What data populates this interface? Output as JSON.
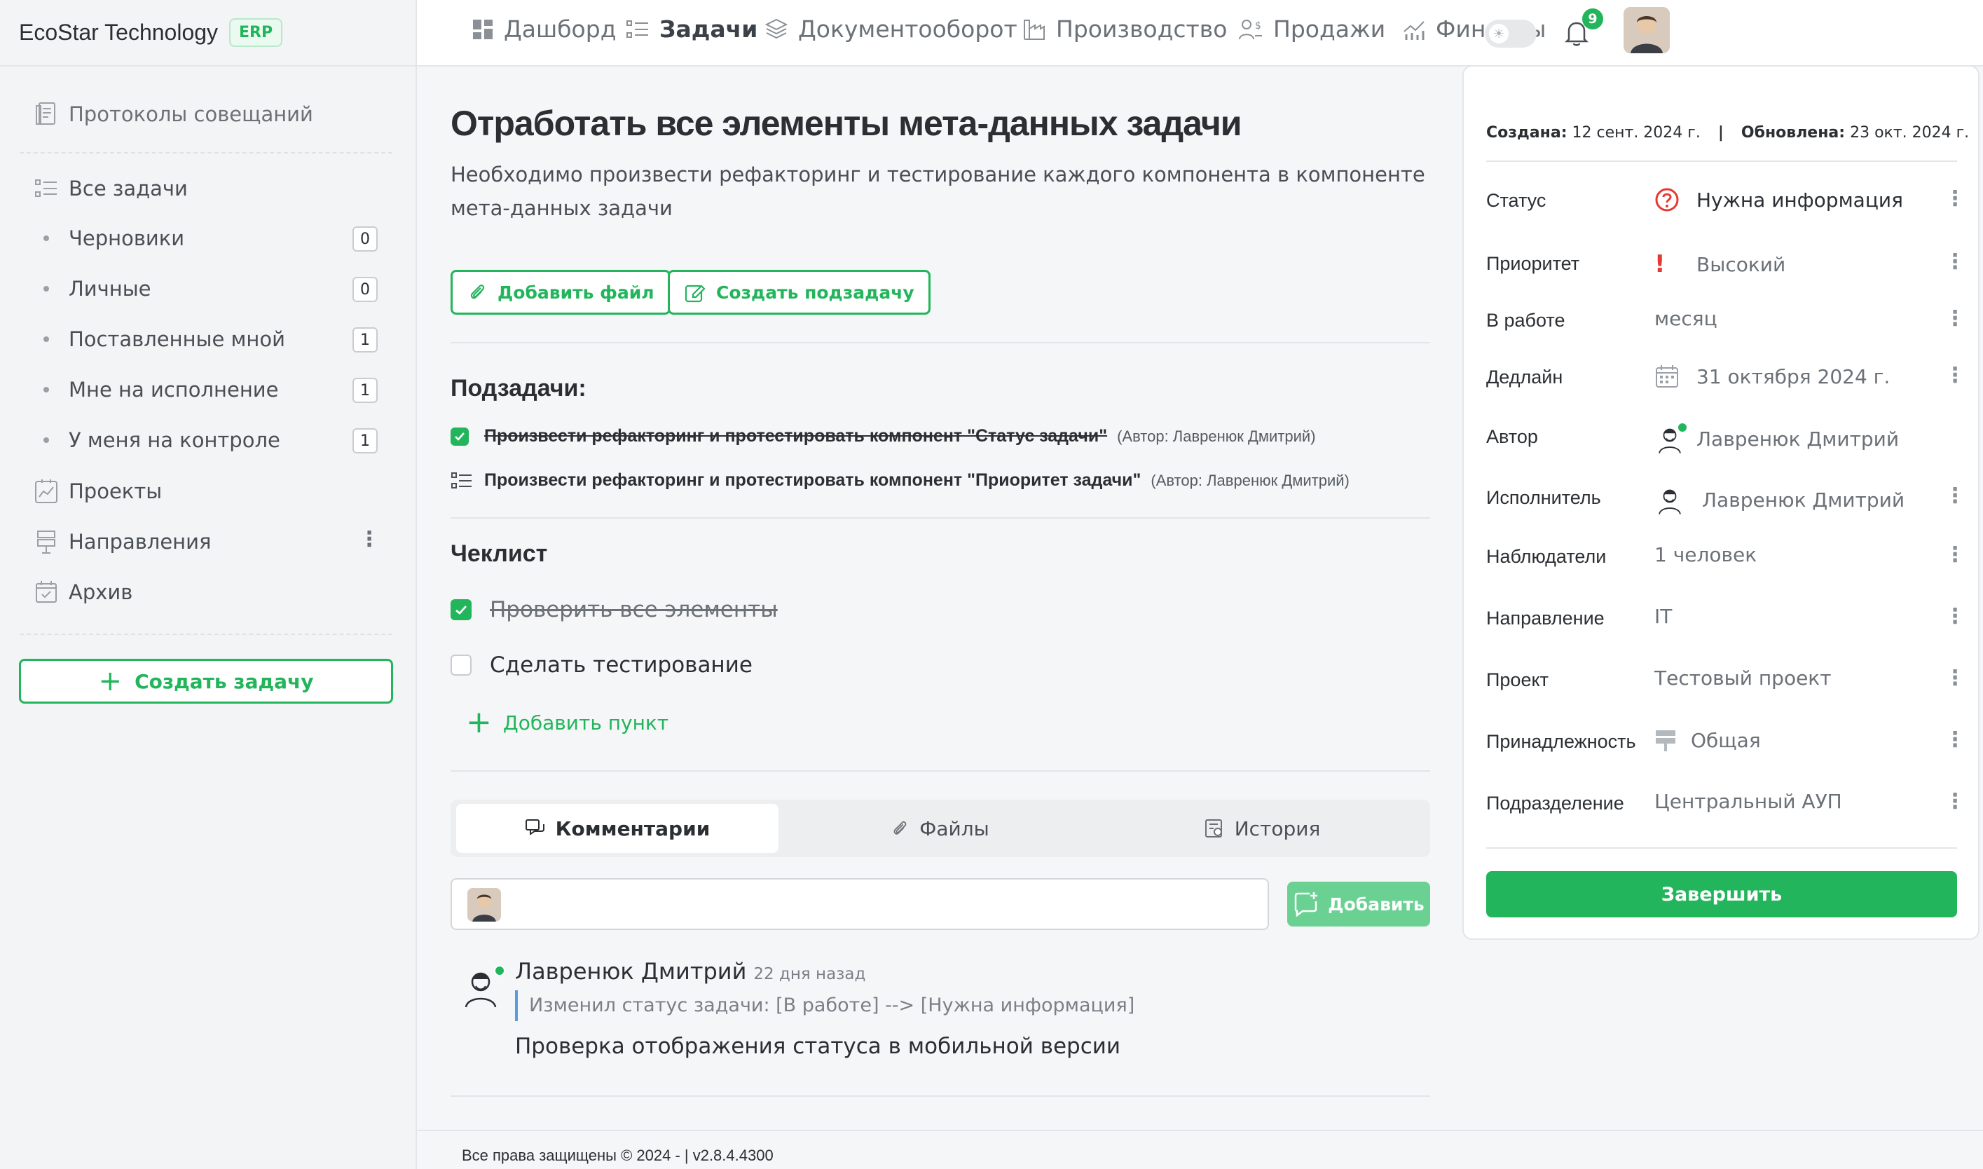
{
  "brand": {
    "name": "EcoStar Technology",
    "badge": "ERP"
  },
  "nav": [
    {
      "label": "Дашборд",
      "icon": "dashboard-icon"
    },
    {
      "label": "Задачи",
      "icon": "tasks-icon",
      "active": true
    },
    {
      "label": "Документооборот",
      "icon": "layers-icon"
    },
    {
      "label": "Производство",
      "icon": "factory-icon"
    },
    {
      "label": "Продажи",
      "icon": "sales-icon"
    },
    {
      "label": "Финансы",
      "icon": "finance-icon"
    }
  ],
  "notifications": {
    "count": "9"
  },
  "sidebar": {
    "protocols": "Протоколы совещаний",
    "all_tasks": "Все задачи",
    "subitems": [
      {
        "label": "Черновики",
        "count": "0"
      },
      {
        "label": "Личные",
        "count": "0"
      },
      {
        "label": "Поставленные мной",
        "count": "1"
      },
      {
        "label": "Мне на исполнение",
        "count": "1"
      },
      {
        "label": "У меня на контроле",
        "count": "1"
      }
    ],
    "projects": "Проекты",
    "directions": "Направления",
    "archive": "Архив",
    "create_task": "Создать задачу"
  },
  "task": {
    "title": "Отработать все элементы мета-данных задачи",
    "description": "Необходимо произвести рефакторинг и тестирование каждого компонента в компоненте мета-данных задачи",
    "add_file": "Добавить файл",
    "create_subtask": "Создать подзадачу"
  },
  "subtasks": {
    "title": "Подзадачи:",
    "items": [
      {
        "name": "Произвести рефакторинг и протестировать компонент \"Статус задачи\"",
        "author": "(Автор: Лавренюк Дмитрий)",
        "done": true
      },
      {
        "name": "Произвести рефакторинг и протестировать компонент \"Приоритет задачи\"",
        "author": "(Автор: Лавренюк Дмитрий)",
        "done": false
      }
    ]
  },
  "checklist": {
    "title": "Чеклист",
    "items": [
      {
        "label": "Проверить все элементы",
        "done": true
      },
      {
        "label": "Сделать тестирование",
        "done": false
      }
    ],
    "add_point": "Добавить пункт"
  },
  "tabs": [
    {
      "label": "Комментарии",
      "active": true
    },
    {
      "label": "Файлы"
    },
    {
      "label": "История"
    }
  ],
  "comment_form": {
    "add_button": "Добавить"
  },
  "comments": [
    {
      "author": "Лавренюк Дмитрий",
      "time": "22 дня назад",
      "quote": "Изменил статус задачи: [В работе] --> [Нужна информация]",
      "text": "Проверка отображения статуса в мобильной версии"
    }
  ],
  "footer": {
    "text": "Все права защищены © 2024 - | v2.8.4.4300"
  },
  "meta": {
    "created_label": "Создана:",
    "created": "12 сент. 2024 г.",
    "separator": "|",
    "updated_label": "Обновлена:",
    "updated": "23 окт. 2024 г.",
    "rows": [
      {
        "label": "Статус",
        "value": "Нужна информация"
      },
      {
        "label": "Приоритет",
        "value": "Высокий"
      },
      {
        "label": "В работе",
        "value": "месяц"
      },
      {
        "label": "Дедлайн",
        "value": "31 октября 2024 г."
      },
      {
        "label": "Автор",
        "value": "Лавренюк Дмитрий"
      },
      {
        "label": "Исполнитель",
        "value": "Лавренюк Дмитрий"
      },
      {
        "label": "Наблюдатели",
        "value": "1 человек"
      },
      {
        "label": "Направление",
        "value": "IT"
      },
      {
        "label": "Проект",
        "value": "Тестовый проект"
      },
      {
        "label": "Принадлежность",
        "value": "Общая"
      },
      {
        "label": "Подразделение",
        "value": "Центральный АУП"
      }
    ],
    "finish": "Завершить"
  },
  "colors": {
    "accent": "#22b55b",
    "status_icon": "#e53935",
    "quote_border": "#5b9be0"
  }
}
